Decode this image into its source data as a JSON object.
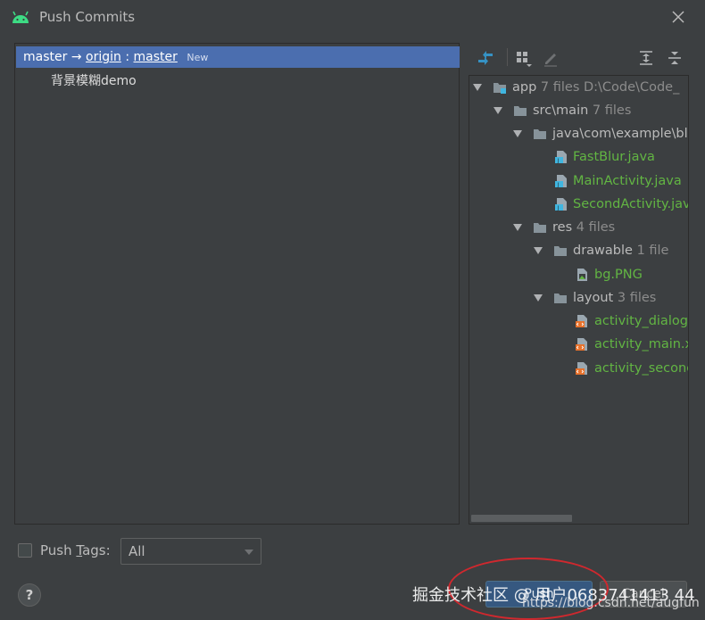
{
  "window": {
    "title": "Push Commits",
    "app_icon": "android-icon",
    "close_icon": "close-icon"
  },
  "commits": {
    "branch": {
      "local": "master",
      "arrow": "→",
      "remote": "origin",
      "separator": ":",
      "target": "master",
      "badge": "New"
    },
    "items": [
      {
        "message": "背景模糊demo"
      }
    ]
  },
  "toolbar": {
    "icons": [
      "diff-icon",
      "group-by-icon",
      "edit-icon",
      "expand-all-icon",
      "collapse-all-icon"
    ]
  },
  "tree": {
    "nodes": [
      {
        "label": "app",
        "count": "7 files",
        "path": "D:\\Code\\Code_",
        "icon": "module-folder-icon",
        "expanded": true
      },
      {
        "label": "src\\main",
        "count": "7 files",
        "icon": "folder-icon",
        "expanded": true
      },
      {
        "label": "java\\com\\example\\bl",
        "count": "",
        "icon": "folder-icon",
        "expanded": true
      },
      {
        "label": "FastBlur.java",
        "icon": "java-file-icon"
      },
      {
        "label": "MainActivity.java",
        "icon": "java-file-icon"
      },
      {
        "label": "SecondActivity.jav",
        "icon": "java-file-icon"
      },
      {
        "label": "res",
        "count": "4 files",
        "icon": "folder-icon",
        "expanded": true
      },
      {
        "label": "drawable",
        "count": "1 file",
        "icon": "folder-icon",
        "expanded": true
      },
      {
        "label": "bg.PNG",
        "icon": "image-file-icon"
      },
      {
        "label": "layout",
        "count": "3 files",
        "icon": "folder-icon",
        "expanded": true
      },
      {
        "label": "activity_dialog.",
        "icon": "xml-file-icon"
      },
      {
        "label": "activity_main.x",
        "icon": "xml-file-icon"
      },
      {
        "label": "activity_second",
        "icon": "xml-file-icon"
      }
    ]
  },
  "push_tags": {
    "label_prefix": "Push ",
    "label_mnemonic": "T",
    "label_suffix": "ags:",
    "checked": false,
    "selected": "All"
  },
  "buttons": {
    "help": "?",
    "push": "Push",
    "cancel": "Cancel"
  },
  "watermark": {
    "line1": "掘金技术社区 @ 用户0683741413 44",
    "line2": "https://blog.csdn.net/augfun"
  },
  "colors": {
    "background": "#3c3f41",
    "selection": "#4b6eaf",
    "added_file": "#62b543",
    "annotation": "#d0282e"
  }
}
